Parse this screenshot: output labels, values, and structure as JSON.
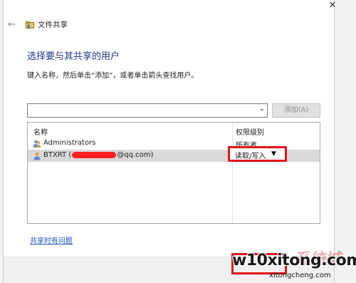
{
  "window": {
    "title": "文件共享",
    "close_glyph": "✕"
  },
  "heading": "选择要与其共享的用户",
  "instructions": "键入名称，然后单击“添加”，或者单击箭头查找用户。",
  "combo": {
    "value": "",
    "arrow_glyph": "⌄"
  },
  "add_button": "添加(A)",
  "list": {
    "col_name": "名称",
    "col_perm": "权限级别",
    "rows": [
      {
        "name": "Administrators",
        "permission": "所有者"
      },
      {
        "name_prefix": "BTXRT (",
        "name_suffix": "@qq.com)",
        "permission": "读取/写入"
      }
    ],
    "caret_glyph": "▼"
  },
  "help_link": "共享时有问题",
  "watermark": {
    "main": "w10xitong.com",
    "cn": "系统城",
    "sub": "xitongcheng.com"
  },
  "colors": {
    "heading": "#1e3a8a",
    "link": "#1a56c4",
    "highlight_red": "#e0141a",
    "redaction": "#ff2020"
  }
}
